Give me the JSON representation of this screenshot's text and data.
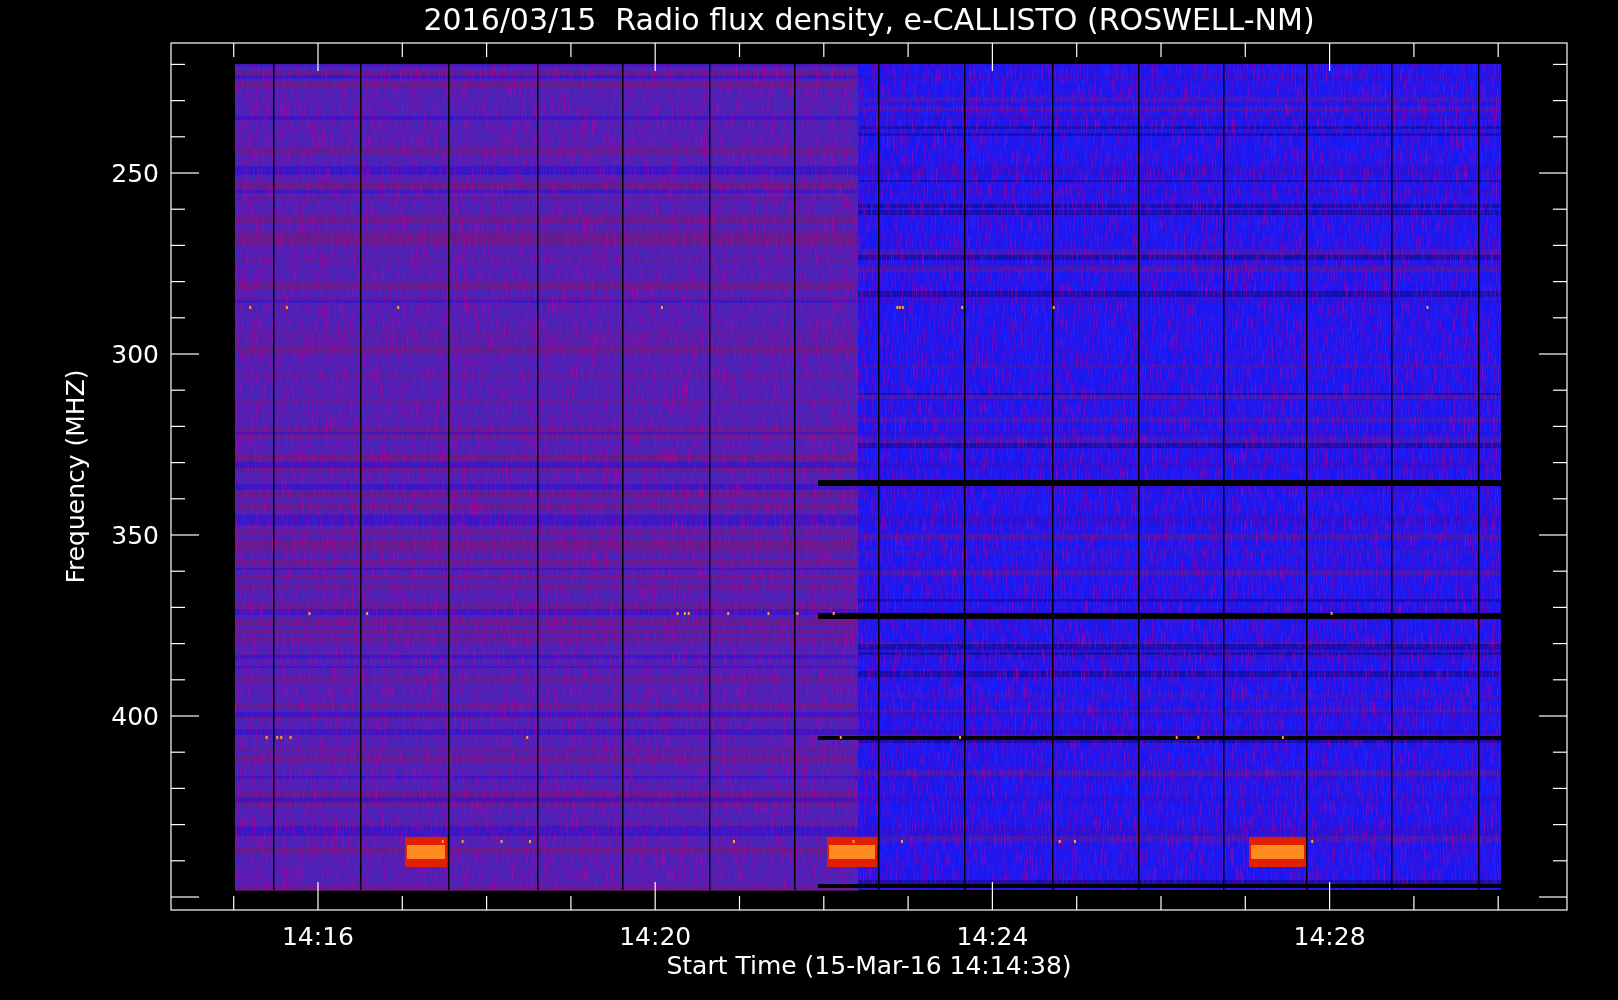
{
  "title": "2016/03/15  Radio flux density, e-CALLISTO (ROSWELL-NM)",
  "plot": {
    "ylabel": "Frequency (MHZ)",
    "xlabel": "Start Time (15-Mar-16 14:14:38)",
    "yticks": [
      "250",
      "300",
      "350",
      "400"
    ],
    "xticks": [
      "14:16",
      "14:20",
      "14:24",
      "14:28"
    ]
  }
}
